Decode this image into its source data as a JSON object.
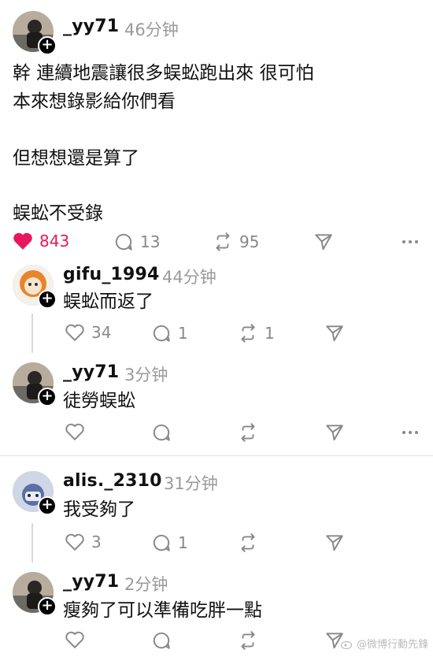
{
  "post": {
    "username": "_yy71",
    "time": "46分钟",
    "lines": [
      "幹 連續地震讓很多蜈蚣跑出來 很可怕",
      "本來想錄影給你們看",
      "但想想還是算了",
      "蜈蚣不受錄"
    ],
    "likes": "843",
    "comments": "13",
    "reposts": "95"
  },
  "replies": [
    {
      "username": "gifu_1994",
      "time": "44分钟",
      "text": "蜈蚣而返了",
      "likes": "34",
      "comments": "1",
      "reposts": "1"
    },
    {
      "username": "_yy71",
      "time": "3分钟",
      "text": "徒勞蜈蚣",
      "likes": "",
      "comments": "",
      "reposts": ""
    },
    {
      "username": "alis._2310",
      "time": "31分钟",
      "text": "我受夠了",
      "likes": "3",
      "comments": "1",
      "reposts": ""
    },
    {
      "username": "_yy71",
      "time": "2分钟",
      "text": "瘦夠了可以準備吃胖一點",
      "likes": "",
      "comments": "",
      "reposts": ""
    }
  ],
  "watermark": "@微博行動先鋒",
  "colors": {
    "like_active": "#e8175d",
    "muted": "#888888"
  }
}
